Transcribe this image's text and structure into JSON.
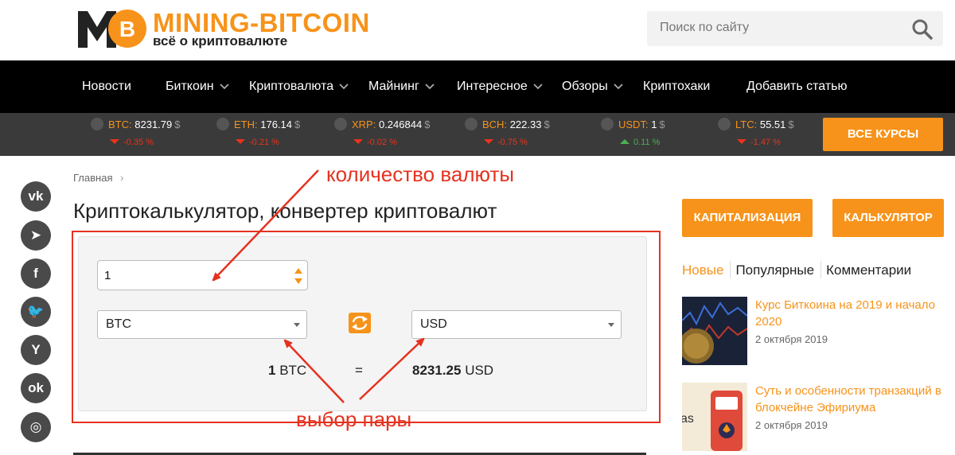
{
  "header": {
    "logo_title": "MINING-BITCOIN",
    "logo_subtitle": "всё о криптовалюте",
    "search_placeholder": "Поиск по сайту"
  },
  "nav": {
    "items": [
      {
        "label": "Новости",
        "dropdown": false
      },
      {
        "label": "Биткоин",
        "dropdown": true
      },
      {
        "label": "Криптовалюта",
        "dropdown": true
      },
      {
        "label": "Майнинг",
        "dropdown": true
      },
      {
        "label": "Интересное",
        "dropdown": true
      },
      {
        "label": "Обзоры",
        "dropdown": true
      },
      {
        "label": "Криптохаки",
        "dropdown": false
      },
      {
        "label": "Добавить статью",
        "dropdown": false
      }
    ]
  },
  "ticker": {
    "items": [
      {
        "symbol": "BTC:",
        "price": "8231.79",
        "currency": "$",
        "change": "-0.35 %",
        "direction": "down"
      },
      {
        "symbol": "ETH:",
        "price": "176.14",
        "currency": "$",
        "change": "-0.21 %",
        "direction": "down"
      },
      {
        "symbol": "XRP:",
        "price": "0.246844",
        "currency": "$",
        "change": "-0.02 %",
        "direction": "down"
      },
      {
        "symbol": "BCH:",
        "price": "222.33",
        "currency": "$",
        "change": "-0.75 %",
        "direction": "down"
      },
      {
        "symbol": "USDT:",
        "price": "1",
        "currency": "$",
        "change": "0.11 %",
        "direction": "up"
      },
      {
        "symbol": "LTC:",
        "price": "55.51",
        "currency": "$",
        "change": "-1.47 %",
        "direction": "down"
      }
    ],
    "all_rates_label": "ВСЕ КУРСЫ"
  },
  "social": [
    "vk-icon",
    "telegram-icon",
    "facebook-icon",
    "twitter-icon",
    "yandex-icon",
    "odnoklassniki-icon",
    "instagram-icon"
  ],
  "social_glyphs": [
    "vk",
    "➤",
    "f",
    "🐦",
    "Y",
    "ok",
    "◎"
  ],
  "main": {
    "breadcrumb": "Главная",
    "breadcrumb_sep": "›",
    "title": "Криптокалькулятор, конвертер криптовалют",
    "calculator": {
      "amount": "1",
      "from_currency": "BTC",
      "to_currency": "USD",
      "result_amount": "1",
      "result_from": "BTC",
      "equals": "=",
      "result_value": "8231.25",
      "result_to": "USD"
    },
    "annotations": {
      "amount_label": "количество валюты",
      "pair_label": "выбор пары"
    }
  },
  "sidebar": {
    "buttons": [
      "КАПИТАЛИЗАЦИЯ",
      "КАЛЬКУЛЯТОР"
    ],
    "tabs": [
      {
        "label": "Новые",
        "active": true
      },
      {
        "label": "Популярные",
        "active": false
      },
      {
        "label": "Комментарии",
        "active": false
      }
    ],
    "news": [
      {
        "title": "Курс Биткоина на 2019 и начало 2020",
        "date": "2 октября 2019"
      },
      {
        "title": "Суть и особенности транзакций в блокчейне Эфириума",
        "date": "2 октября 2019"
      }
    ]
  },
  "colors": {
    "accent": "#f7931a",
    "nav_bg": "#000000",
    "ticker_bg": "#3a3a3a",
    "annotation": "#e53220",
    "down": "#e8331c",
    "up": "#4caf50"
  }
}
